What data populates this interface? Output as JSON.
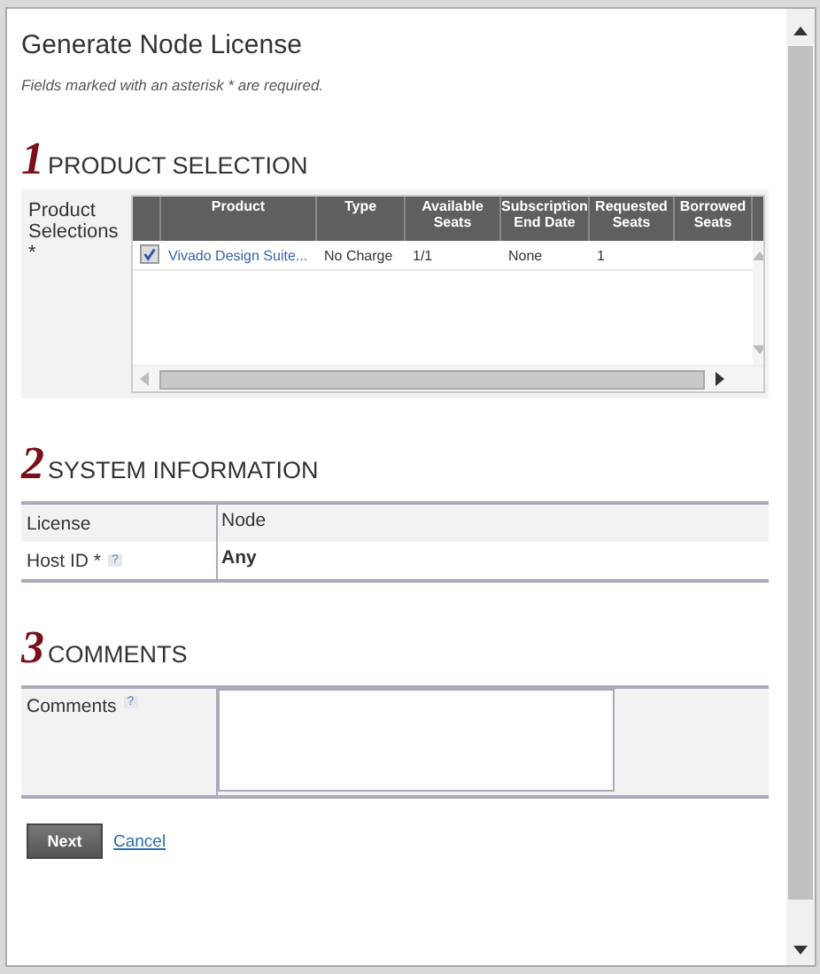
{
  "dialog": {
    "title": "Generate Node License",
    "note": "Fields marked with an asterisk * are required."
  },
  "sections": [
    {
      "number": "1",
      "title": "PRODUCT SELECTION",
      "kind": "products"
    },
    {
      "number": "2",
      "title": "SYSTEM INFORMATION",
      "kind": "system"
    },
    {
      "number": "3",
      "title": "COMMENTS",
      "kind": "comments"
    }
  ],
  "product_selection": {
    "label": "Product Selections *",
    "columns": [
      "Product",
      "Type",
      "Available Seats",
      "Subscription End Date",
      "Requested Seats",
      "Borrowed Seats"
    ],
    "rows": [
      {
        "checked": true,
        "cells": [
          "Vivado Design Suite...",
          "No Charge",
          "1/1",
          "None",
          "1",
          ""
        ]
      }
    ]
  },
  "system_information": {
    "rows": [
      {
        "label": "License",
        "value": "Node",
        "help": ""
      },
      {
        "label": "Host ID *",
        "value": "Any",
        "help": "?"
      }
    ]
  },
  "comments": {
    "label": "Comments",
    "help": "?"
  },
  "buttons": {
    "next": "Next",
    "cancel": "Cancel"
  }
}
